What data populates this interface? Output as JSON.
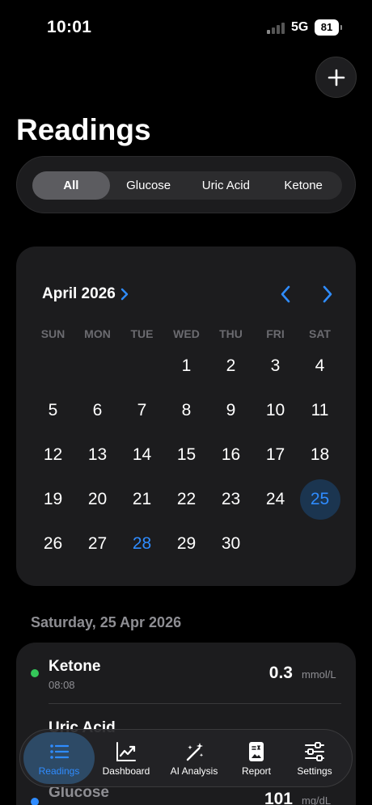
{
  "status_bar": {
    "time": "10:01",
    "network": "5G",
    "battery": "81"
  },
  "header": {
    "title": "Readings",
    "add_icon": "plus-icon"
  },
  "filter": {
    "options": [
      "All",
      "Glucose",
      "Uric Acid",
      "Ketone"
    ],
    "selected": "All"
  },
  "calendar": {
    "month_label": "April 2026",
    "weekdays": [
      "SUN",
      "MON",
      "TUE",
      "WED",
      "THU",
      "FRI",
      "SAT"
    ],
    "days": [
      "",
      "",
      "",
      "1",
      "2",
      "3",
      "4",
      "5",
      "6",
      "7",
      "8",
      "9",
      "10",
      "11",
      "12",
      "13",
      "14",
      "15",
      "16",
      "17",
      "18",
      "19",
      "20",
      "21",
      "22",
      "23",
      "24",
      "25",
      "26",
      "27",
      "28",
      "29",
      "30",
      "",
      ""
    ],
    "selected_day": "25",
    "highlight_day": "28",
    "accent": "#2f8cff"
  },
  "date_header": "Saturday, 25 Apr 2026",
  "readings": [
    {
      "name": "Ketone",
      "time": "08:08",
      "value": "0.3",
      "unit": "mmol/L",
      "color": "#34c759"
    },
    {
      "name": "Uric Acid",
      "time": "",
      "value": "",
      "unit": "",
      "color": "#ff9f0a"
    },
    {
      "name": "Glucose",
      "time": "",
      "value": "101",
      "unit": "mg/dL",
      "color": "#2f8cff"
    }
  ],
  "tabs": [
    {
      "label": "Readings",
      "icon": "list-icon",
      "active": true
    },
    {
      "label": "Dashboard",
      "icon": "chart-icon",
      "active": false
    },
    {
      "label": "AI Analysis",
      "icon": "sparkle-wand-icon",
      "active": false
    },
    {
      "label": "Report",
      "icon": "report-icon",
      "active": false
    },
    {
      "label": "Settings",
      "icon": "sliders-icon",
      "active": false
    }
  ]
}
